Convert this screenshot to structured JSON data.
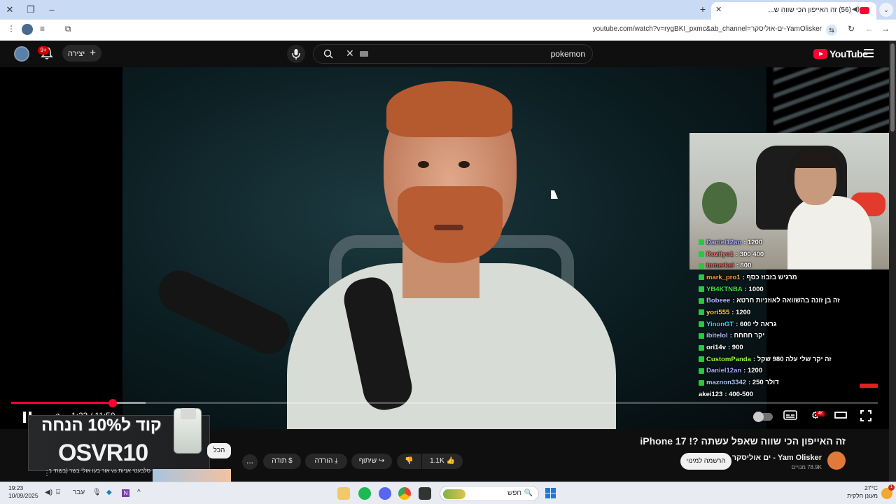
{
  "browser": {
    "tab_title": "(56) זה האייפון הכי שווה ש...",
    "url": "youtube.com/watch?v=rygBKI_pxmc&ab_channel=ים-אוליסקר-YamOlisker"
  },
  "masthead": {
    "notif_count": "9+",
    "create_label": "יצירה",
    "search_query": "pokemon",
    "logo_text": "YouTube"
  },
  "chat": {
    "lines": [
      {
        "name": "Daniel12an",
        "msg": ": 1200",
        "color": "#a9a9ff"
      },
      {
        "name": "Rozilyo1",
        "msg": ": 300 400",
        "color": "#ff6b6b"
      },
      {
        "name": "tomerkei",
        "msg": ": 800",
        "color": "#ff4b4b"
      },
      {
        "name": "mark_pro1",
        "msg": ": מרגיש בזבוז כסף",
        "color": "#ff9d3c"
      },
      {
        "name": "YB4KTNBA",
        "msg": ": 1000",
        "color": "#3ce03c"
      },
      {
        "name": "Bobeee",
        "msg": ": זה בן זונה בהשוואה לאוזניות חרטא",
        "color": "#b8b8ff"
      },
      {
        "name": "yori555",
        "msg": ": 1200",
        "color": "#ffd23c"
      },
      {
        "name": "YinonGT",
        "msg": ": גראה לי 600",
        "color": "#3cd4ff"
      },
      {
        "name": "ibitelol",
        "msg": ": יקר חחחח",
        "color": "#b8b8ff"
      },
      {
        "name": "ori14v",
        "msg": ": 900",
        "color": "#ffffff"
      },
      {
        "name": "CustomPanda",
        "msg": ": זה יקר שלי עלה 980 שקל",
        "color": "#9dff3c"
      },
      {
        "name": "Daniel12an",
        "msg": ": 1200",
        "color": "#a9a9ff"
      },
      {
        "name": "maznon3342",
        "msg": ": דולר 250",
        "color": "#a9c9ff"
      },
      {
        "name": "akei123",
        "msg": ": 400-500",
        "color": "#ffffff"
      }
    ]
  },
  "player": {
    "current_time": "1:23",
    "duration": "11:50",
    "time_display": "1:23 / 11:50",
    "progress_fraction": 0.117,
    "buffered_fraction": 0.155,
    "quality_badge": "4K"
  },
  "promo": {
    "line1": "קוד ל10% הנחה",
    "code": "OSVR10",
    "all_pill": "הכל"
  },
  "video": {
    "title": "זה האייפון הכי שווה שאפל עשתה ?! iPhone 17",
    "channel": "Yam Olisker - ים אוליסקר",
    "subscribers": "78.9K מנויים",
    "subscribe_label": "הרשמה למינוי",
    "likes": "1.1K",
    "share_label": "שיתוף",
    "download_label": "הורדה",
    "thanks_label": "תודה",
    "more_label": "...",
    "recommended_title": "סלבעטי אניות vs אור בעו אולי בשר (בשתי מוקדים לביצוע ודיגסן?)"
  },
  "taskbar": {
    "time": "19:23",
    "date": "10/09/2025",
    "lang": "עבר",
    "search_label": "חפש",
    "temperature": "27°C",
    "weather_desc": "מעונן חלקית",
    "weather_badge": "1"
  }
}
